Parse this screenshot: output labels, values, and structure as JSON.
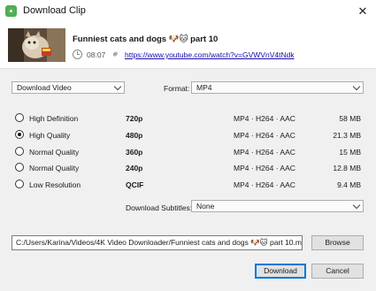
{
  "window": {
    "title": "Download Clip",
    "close_glyph": "✕"
  },
  "video": {
    "title": "Funniest cats and dogs 🐶🐱 part 10",
    "duration": "08:07",
    "url": "https://www.youtube.com/watch?v=GVWVnV4tNdk"
  },
  "download_type": {
    "selected": "Download Video"
  },
  "format": {
    "label": "Format:",
    "selected": "MP4"
  },
  "qualities": [
    {
      "name": "High Definition",
      "resolution": "720p",
      "format": "MP4 · H264 · AAC",
      "size": "58 MB",
      "selected": false
    },
    {
      "name": "High Quality",
      "resolution": "480p",
      "format": "MP4 · H264 · AAC",
      "size": "21.3 MB",
      "selected": true
    },
    {
      "name": "Normal Quality",
      "resolution": "360p",
      "format": "MP4 · H264 · AAC",
      "size": "15 MB",
      "selected": false
    },
    {
      "name": "Normal Quality",
      "resolution": "240p",
      "format": "MP4 · H264 · AAC",
      "size": "12.8 MB",
      "selected": false
    },
    {
      "name": "Low Resolution",
      "resolution": "QCIF",
      "format": "MP4 · H264 · AAC",
      "size": "9.4 MB",
      "selected": false
    }
  ],
  "subtitles": {
    "label": "Download Subtitles:",
    "selected": "None"
  },
  "save_path": "C:/Users/Karina/Videos/4K Video Downloader/Funniest cats and dogs 🐶🐱 part 10.mp4",
  "buttons": {
    "browse": "Browse",
    "download": "Download",
    "cancel": "Cancel"
  },
  "icons": {
    "app": "app-logo-icon",
    "close": "close-icon",
    "clock": "clock-icon",
    "link": "link-icon"
  },
  "colors": {
    "link": "#1a0dab",
    "accent": "#0078d7",
    "app_icon": "#4caf50"
  }
}
